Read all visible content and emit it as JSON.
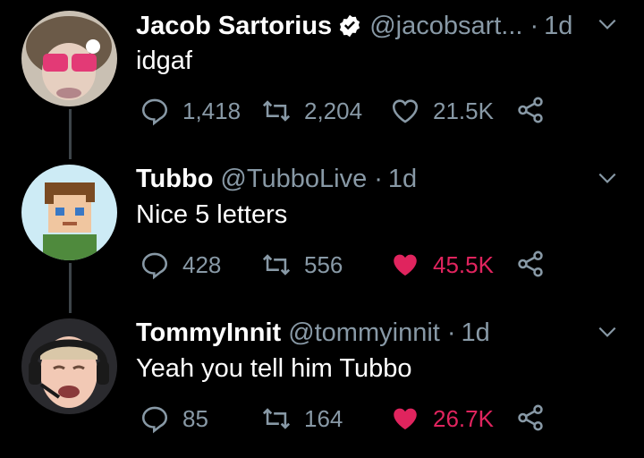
{
  "tweets": [
    {
      "display_name": "Jacob Sartorius",
      "verified": true,
      "handle": "@jacobsart...",
      "separator": "·",
      "time": "1d",
      "text": "idgaf",
      "replies": "1,418",
      "retweets": "2,204",
      "likes": "21.5K",
      "liked": false
    },
    {
      "display_name": "Tubbo",
      "verified": false,
      "handle": "@TubboLive",
      "separator": "·",
      "time": "1d",
      "text": "Nice 5 letters",
      "replies": "428",
      "retweets": "556",
      "likes": "45.5K",
      "liked": true
    },
    {
      "display_name": "TommyInnit",
      "verified": false,
      "handle": "@tommyinnit",
      "separator": "·",
      "time": "1d",
      "text": "Yeah you tell him Tubbo",
      "replies": "85",
      "retweets": "164",
      "likes": "26.7K",
      "liked": true
    }
  ],
  "colors": {
    "background": "#000000",
    "muted": "#8899a6",
    "like": "#e0245e",
    "verified": "#ffffff",
    "thread_line": "#3d4449"
  },
  "icons": [
    "reply-icon",
    "retweet-icon",
    "heart-icon",
    "share-icon",
    "chevron-down-icon",
    "verified-badge-icon"
  ]
}
